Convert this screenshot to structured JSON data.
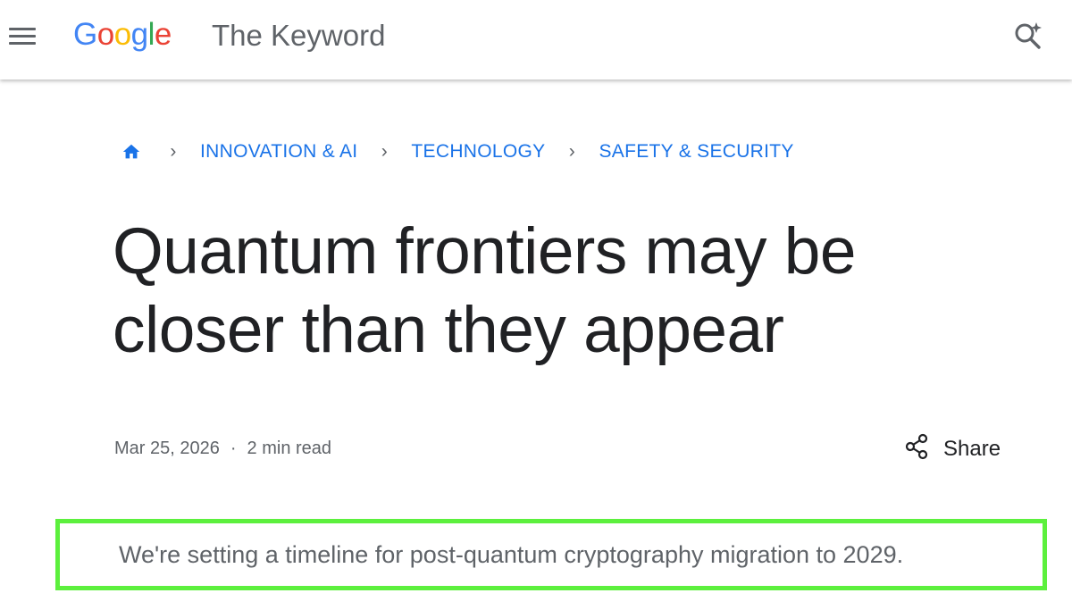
{
  "header": {
    "logo": {
      "G": "G",
      "o1": "o",
      "o2": "o",
      "g": "g",
      "l": "l",
      "e": "e"
    },
    "site_title": "The Keyword",
    "icons": {
      "menu": "hamburger-menu-icon",
      "search": "search-sparkle-icon"
    }
  },
  "breadcrumb": {
    "home_icon": "home-icon",
    "separator": "›",
    "items": [
      {
        "label": "INNOVATION & AI"
      },
      {
        "label": "TECHNOLOGY"
      },
      {
        "label": "SAFETY & SECURITY"
      }
    ]
  },
  "article": {
    "title_line1": "Quantum frontiers may be",
    "title_line2": "closer than they appear",
    "date": "Mar 25, 2026",
    "dot": "·",
    "read_time": "2 min read",
    "share_label": "Share",
    "share_icon": "share-icon",
    "summary": "We're setting a timeline for post-quantum cryptography migration to 2029."
  },
  "colors": {
    "link": "#1a73e8",
    "text": "#202124",
    "muted": "#5f6368",
    "highlight_border": "#5cf03d"
  }
}
